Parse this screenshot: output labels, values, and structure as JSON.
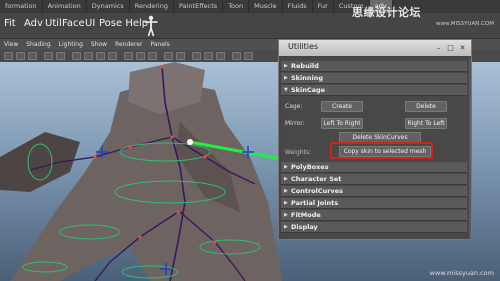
{
  "menu_tabs": [
    "formation",
    "Animation",
    "Dynamics",
    "Rendering",
    "PaintEffects",
    "Toon",
    "Muscle",
    "Fluids",
    "Fur",
    "Custom",
    "adv"
  ],
  "active_tab": "adv",
  "brand": {
    "name": "思缘设计论坛",
    "url": "www.MISSYUAN.COM",
    "bottom": "www.missyuan.com"
  },
  "shelf": {
    "buttons": [
      "Fit",
      "Adv",
      "Util",
      "Face",
      "UI",
      "Pose Help"
    ],
    "icon": "t-pose-icon"
  },
  "viewport": {
    "menu": [
      "View",
      "Shading",
      "Lighting",
      "Show",
      "Renderer",
      "Panels"
    ]
  },
  "utilities": {
    "title": "Utilities",
    "sections_top": [
      {
        "label": "Rebuild",
        "expanded": false
      },
      {
        "label": "Skinning",
        "expanded": false
      },
      {
        "label": "SkinCage",
        "expanded": true
      }
    ],
    "skincage": {
      "cage_label": "Cage:",
      "create": "Create",
      "delete": "Delete",
      "mirror_label": "Mirror:",
      "left_to_right": "Left To Right",
      "right_to_left": "Right To Left",
      "delete_skincurves": "Delete SkinCurves",
      "weights_label": "Weights:",
      "copy_skin": "Copy skin to selected mesh"
    },
    "sections_bottom": [
      {
        "label": "PolyBoxes"
      },
      {
        "label": "Character Set"
      },
      {
        "label": "ControlCurves"
      },
      {
        "label": "Partial Joints"
      },
      {
        "label": "FitMode"
      },
      {
        "label": "Display"
      }
    ]
  },
  "colors": {
    "highlight": "#d32020",
    "joint": "#22ee44",
    "control": "#1e3fcc",
    "ring": "#2fbf6f"
  }
}
